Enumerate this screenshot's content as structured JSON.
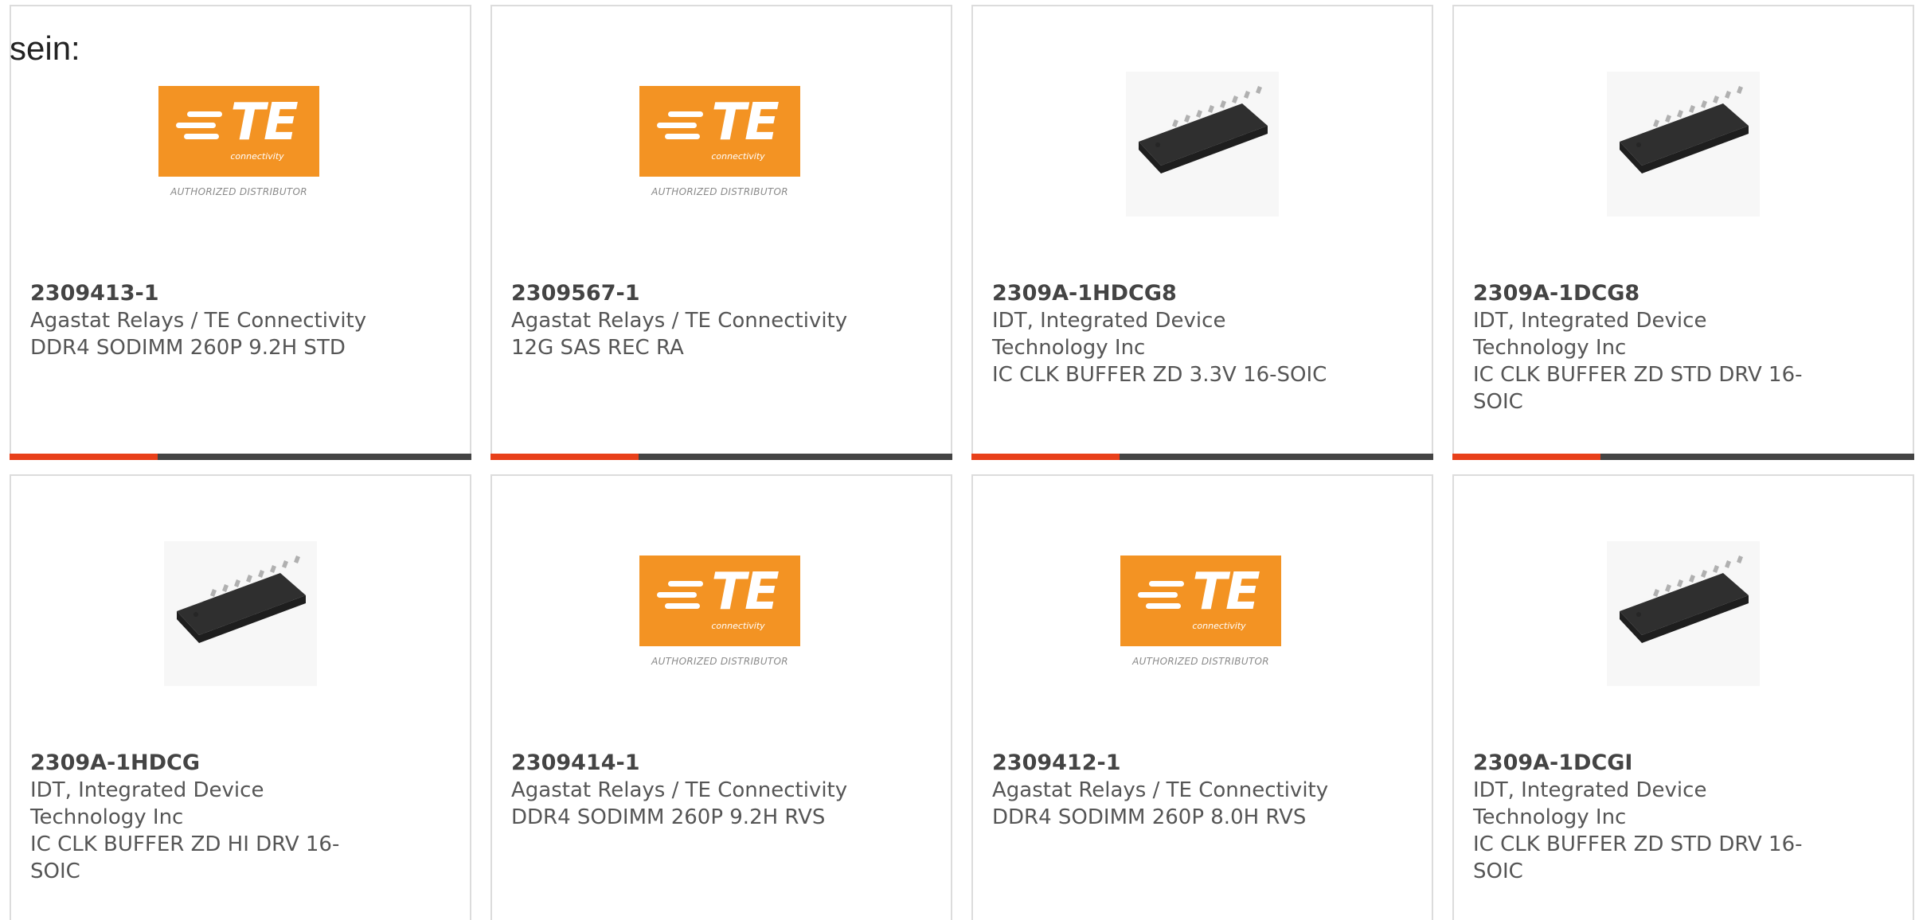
{
  "intro_text": "sein:",
  "colors": {
    "te_orange": "#f39323",
    "accent_red": "#e8401a",
    "accent_dark": "#444444",
    "card_border": "#dcdcdc"
  },
  "te_logo": {
    "wordmark": "TE",
    "sub": "connectivity",
    "tag": "AUTHORIZED DISTRIBUTOR"
  },
  "products": [
    {
      "part_number": "2309413-1",
      "manufacturer": "Agastat Relays / TE Connectivity",
      "manufacturer_lines": [
        "Agastat Relays / TE Connectivity"
      ],
      "description_lines": [
        "DDR4 SODIMM 260P 9.2H STD"
      ],
      "image": "te-logo",
      "accent_fraction": 0.32
    },
    {
      "part_number": "2309567-1",
      "manufacturer": "Agastat Relays / TE Connectivity",
      "manufacturer_lines": [
        "Agastat Relays / TE Connectivity"
      ],
      "description_lines": [
        "12G SAS REC RA"
      ],
      "image": "te-logo",
      "accent_fraction": 0.32
    },
    {
      "part_number": "2309A-1HDCG8",
      "manufacturer": "IDT, Integrated Device Technology Inc",
      "manufacturer_lines": [
        "IDT, Integrated Device",
        "Technology Inc"
      ],
      "description_lines": [
        "IC CLK BUFFER ZD 3.3V 16-SOIC"
      ],
      "image": "soic-chip",
      "accent_fraction": 0.32
    },
    {
      "part_number": "2309A-1DCG8",
      "manufacturer": "IDT, Integrated Device Technology Inc",
      "manufacturer_lines": [
        "IDT, Integrated Device",
        "Technology Inc"
      ],
      "description_lines": [
        "IC CLK BUFFER ZD STD DRV 16-",
        "SOIC"
      ],
      "image": "soic-chip",
      "accent_fraction": 0.32
    },
    {
      "part_number": "2309A-1HDCG",
      "manufacturer": "IDT, Integrated Device Technology Inc",
      "manufacturer_lines": [
        "IDT, Integrated Device",
        "Technology Inc"
      ],
      "description_lines": [
        "IC CLK BUFFER ZD HI DRV 16-",
        "SOIC"
      ],
      "image": "soic-chip",
      "accent_fraction": null
    },
    {
      "part_number": "2309414-1",
      "manufacturer": "Agastat Relays / TE Connectivity",
      "manufacturer_lines": [
        "Agastat Relays / TE Connectivity"
      ],
      "description_lines": [
        "DDR4 SODIMM 260P 9.2H RVS"
      ],
      "image": "te-logo",
      "accent_fraction": null
    },
    {
      "part_number": "2309412-1",
      "manufacturer": "Agastat Relays / TE Connectivity",
      "manufacturer_lines": [
        "Agastat Relays / TE Connectivity"
      ],
      "description_lines": [
        "DDR4 SODIMM 260P 8.0H RVS"
      ],
      "image": "te-logo",
      "accent_fraction": null
    },
    {
      "part_number": "2309A-1DCGI",
      "manufacturer": "IDT, Integrated Device Technology Inc",
      "manufacturer_lines": [
        "IDT, Integrated Device",
        "Technology Inc"
      ],
      "description_lines": [
        "IC CLK BUFFER ZD STD DRV 16-",
        "SOIC"
      ],
      "image": "soic-chip",
      "accent_fraction": null
    }
  ]
}
